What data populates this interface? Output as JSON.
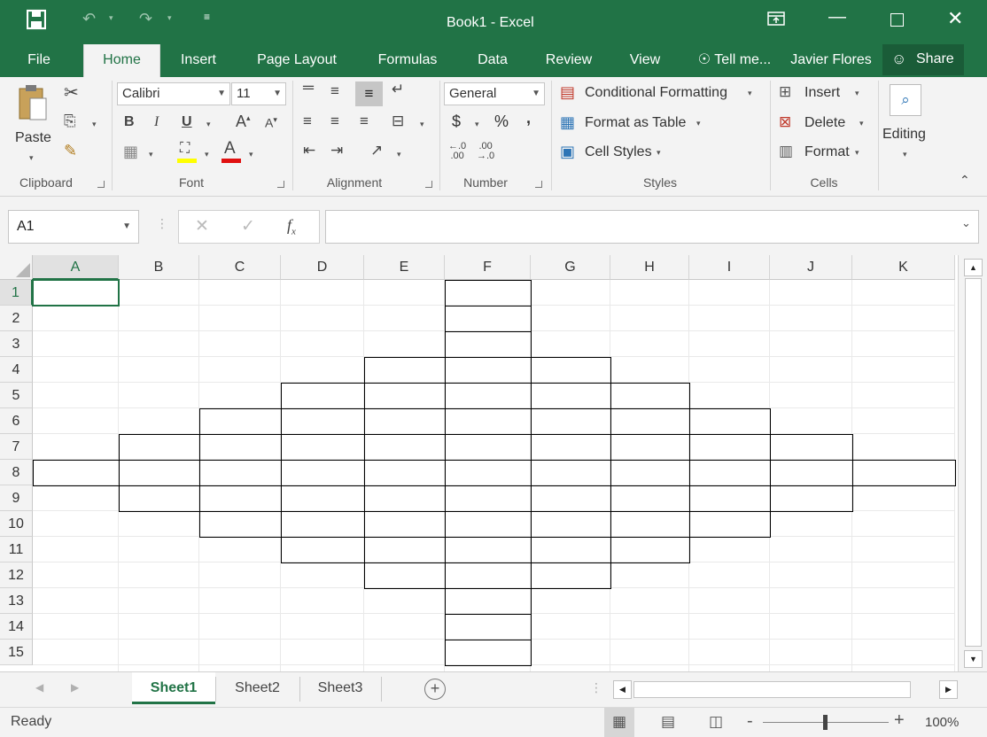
{
  "window": {
    "title": "Book1 - Excel"
  },
  "tabs": [
    "File",
    "Home",
    "Insert",
    "Page Layout",
    "Formulas",
    "Data",
    "Review",
    "View"
  ],
  "tell_me": "Tell me...",
  "user": "Javier Flores",
  "share_label": "Share",
  "ribbon": {
    "clipboard": {
      "paste": "Paste",
      "label": "Clipboard"
    },
    "font": {
      "name": "Calibri",
      "size": "11",
      "label": "Font"
    },
    "alignment": {
      "label": "Alignment"
    },
    "number": {
      "format": "General",
      "currency": "$",
      "percent": "%",
      "comma": ",",
      "label": "Number"
    },
    "styles": {
      "conditional": "Conditional Formatting",
      "table": "Format as Table",
      "cell_styles": "Cell Styles",
      "label": "Styles"
    },
    "cells": {
      "insert": "Insert",
      "delete": "Delete",
      "format": "Format",
      "label": "Cells"
    },
    "editing": {
      "label": "Editing"
    }
  },
  "formula_bar": {
    "name_box": "A1",
    "formula": ""
  },
  "columns": [
    "A",
    "B",
    "C",
    "D",
    "E",
    "F",
    "G",
    "H",
    "I",
    "J",
    "K"
  ],
  "rows": [
    "1",
    "2",
    "3",
    "4",
    "5",
    "6",
    "7",
    "8",
    "9",
    "10",
    "11",
    "12",
    "13",
    "14",
    "15"
  ],
  "active_cell": "A1",
  "sheets": [
    "Sheet1",
    "Sheet2",
    "Sheet3"
  ],
  "active_sheet": "Sheet1",
  "status": {
    "ready": "Ready",
    "zoom": "100%",
    "zoom_minus": "-",
    "zoom_plus": "+"
  },
  "colors": {
    "accent": "#217346"
  }
}
